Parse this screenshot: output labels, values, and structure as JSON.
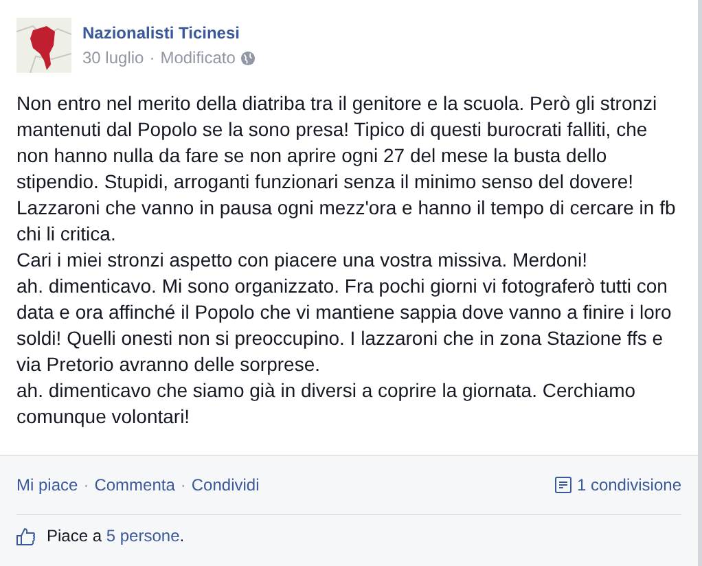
{
  "post": {
    "author": "Nazionalisti Ticinesi",
    "date": "30 luglio",
    "separator": "·",
    "edited": "Modificato",
    "paragraphs": [
      "Non entro nel merito della diatriba tra il genitore e la scuola. Però gli stronzi mantenuti dal Popolo se la sono presa! Tipico di questi burocrati falliti, che non hanno nulla da fare se non aprire ogni 27 del mese la busta dello stipendio. Stupidi, arroganti funzionari senza il minimo senso del dovere! Lazzaroni che vanno in pausa ogni mezz'ora e hanno il tempo di cercare in fb chi li critica.",
      "Cari i miei stronzi aspetto con piacere una vostra missiva. Merdoni!",
      "ah. dimenticavo. Mi sono organizzato. Fra pochi giorni vi fotograferò tutti con data e ora affinché il Popolo che vi mantiene sappia dove vanno a finire i loro soldi! Quelli onesti non si preoccupino. I lazzaroni che in zona Stazione ffs e via Pretorio avranno delle sorprese.",
      "ah. dimenticavo che siamo già in diversi a coprire la giornata. Cerchiamo comunque volontari!"
    ]
  },
  "actions": [
    {
      "label": "Mi piace"
    },
    {
      "separator": "·",
      "label": "Commenta"
    },
    {
      "separator": "·",
      "label": "Condividi"
    }
  ],
  "shares": "1 condivisione",
  "likes": {
    "prefix": "Piace a",
    "link": "5 persone",
    "suffix": "."
  }
}
